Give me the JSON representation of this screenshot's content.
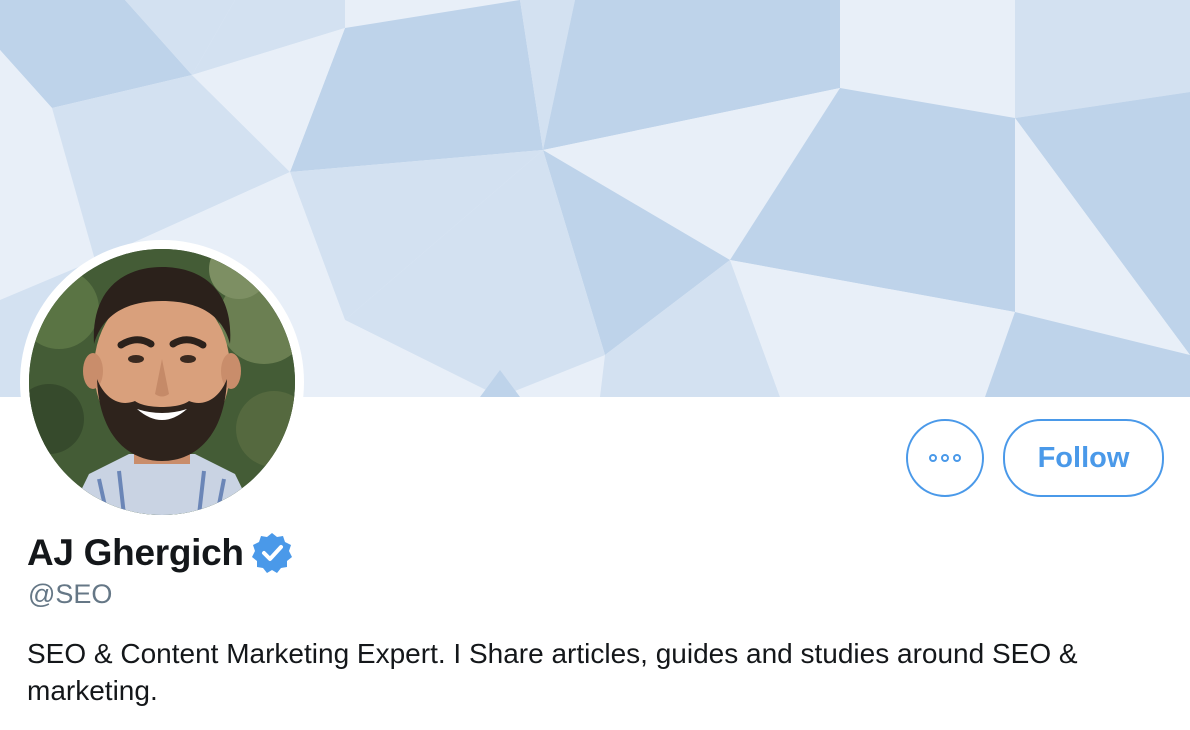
{
  "profile": {
    "display_name": "AJ Ghergich",
    "handle": "@SEO",
    "bio": "SEO & Content Marketing Expert. I Share articles, guides and studies around SEO & marketing.",
    "verified": true
  },
  "actions": {
    "more_icon": "more-horizontal-icon",
    "follow_label": "Follow"
  },
  "colors": {
    "accent": "#4a99e9",
    "name_text": "#14171a",
    "handle_text": "#657786",
    "banner_light": "#e8eff8",
    "banner_mid": "#d3e1f1",
    "banner_dark": "#bed3ea"
  }
}
